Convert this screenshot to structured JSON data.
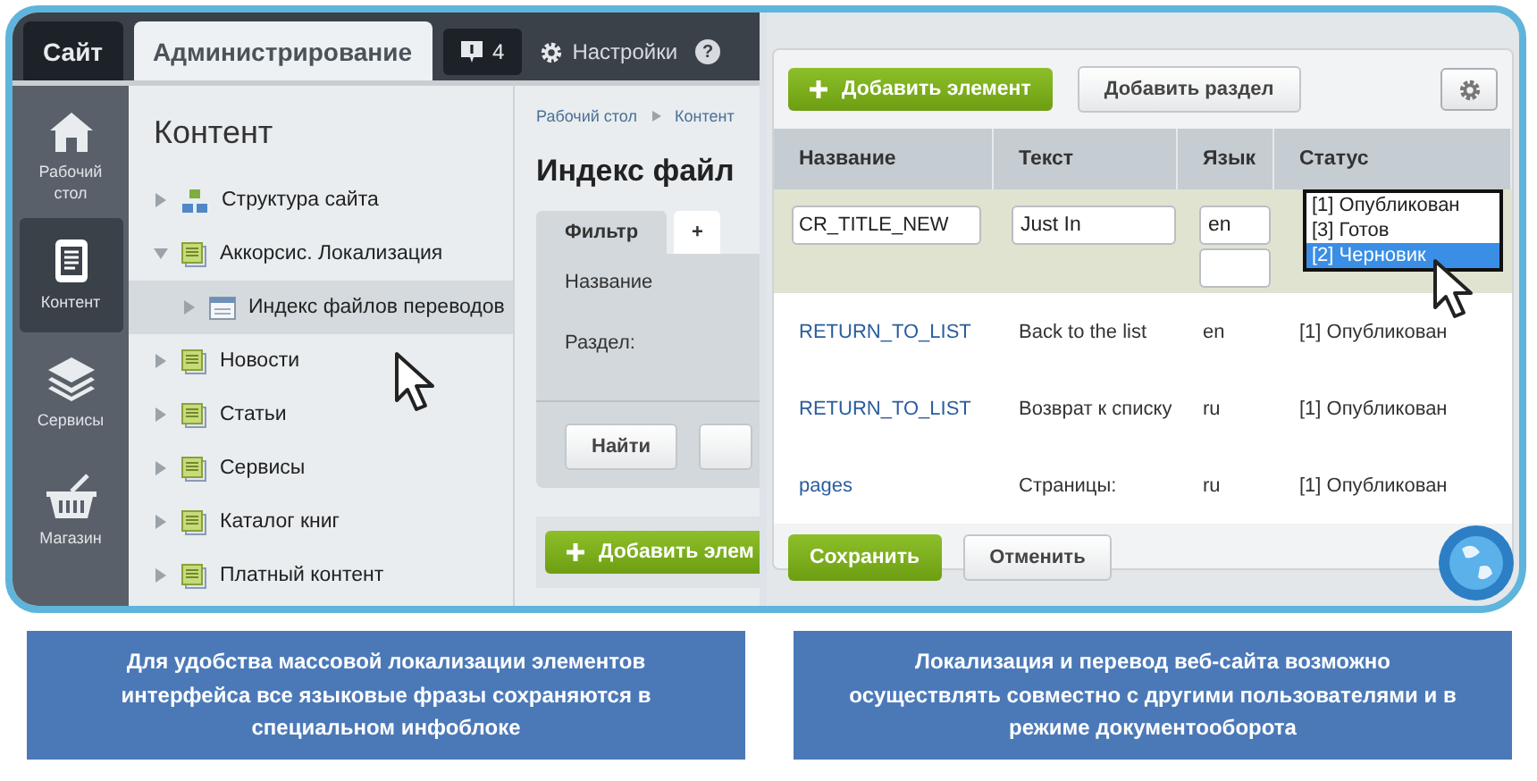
{
  "admin": {
    "top_tabs": [
      {
        "label": "Сайт",
        "selected": false
      },
      {
        "label": "Администрирование",
        "selected": true
      }
    ],
    "notifications": {
      "count": "4"
    },
    "settings": {
      "label": "Настройки"
    },
    "help": {
      "label": "?"
    },
    "sidebar": {
      "items": [
        {
          "label": "Рабочий стол",
          "kind": "home",
          "selected": false
        },
        {
          "label": "Контент",
          "kind": "content",
          "selected": true
        },
        {
          "label": "Сервисы",
          "kind": "services",
          "selected": false
        },
        {
          "label": "Магазин",
          "kind": "shop",
          "selected": false
        }
      ]
    },
    "tree": {
      "title": "Контент",
      "items": [
        {
          "label": "Структура сайта",
          "kind": "structure",
          "expanded": false,
          "selected": false
        },
        {
          "label": "Аккорсис. Локализация",
          "kind": "section",
          "expanded": true,
          "selected": false,
          "children": [
            {
              "label": "Индекс файлов переводов",
              "kind": "list",
              "expanded": false,
              "selected": true
            }
          ]
        },
        {
          "label": "Новости",
          "kind": "section",
          "expanded": false,
          "selected": false
        },
        {
          "label": "Статьи",
          "kind": "section",
          "expanded": false,
          "selected": false
        },
        {
          "label": "Сервисы",
          "kind": "section",
          "expanded": false,
          "selected": false
        },
        {
          "label": "Каталог книг",
          "kind": "section",
          "expanded": false,
          "selected": false
        },
        {
          "label": "Платный контент",
          "kind": "section",
          "expanded": false,
          "selected": false
        }
      ]
    },
    "content": {
      "breadcrumb": [
        "Рабочий стол",
        "Контент"
      ],
      "title": "Индекс файл",
      "filter_tabs": [
        {
          "label": "Фильтр",
          "selected": true
        },
        {
          "label": "+",
          "selected": false
        }
      ],
      "filter_fields": [
        "Название",
        "Раздел:"
      ],
      "find_button": "Найти",
      "add_button": "Добавить элем"
    }
  },
  "editor": {
    "toolbar": {
      "add_element": "Добавить элемент",
      "add_section": "Добавить раздел"
    },
    "columns": [
      "Название",
      "Текст",
      "Язык",
      "Статус"
    ],
    "edit_row": {
      "name": "CR_TITLE_NEW",
      "text": "Just In",
      "language": "en"
    },
    "status_options": [
      {
        "label": "[1] Опубликован",
        "selected": false
      },
      {
        "label": "[3] Готов",
        "selected": false
      },
      {
        "label": "[2] Черновик",
        "selected": true
      }
    ],
    "rows": [
      {
        "name": "RETURN_TO_LIST",
        "text": "Back to the list",
        "language": "en",
        "status": "[1] Опубликован"
      },
      {
        "name": "RETURN_TO_LIST",
        "text": "Возврат к списку",
        "language": "ru",
        "status": "[1] Опубликован"
      },
      {
        "name": "pages",
        "text": "Страницы:",
        "language": "ru",
        "status": "[1] Опубликован"
      }
    ],
    "footer": {
      "save": "Сохранить",
      "cancel": "Отменить"
    }
  },
  "captions": [
    "Для удобства массовой локализации элементов интерфейса все языковые фразы сохраняются в специальном инфоблоке",
    "Локализация и перевод веб-сайта возможно осуществлять совместно с другими пользователями и в режиме документооборота"
  ]
}
